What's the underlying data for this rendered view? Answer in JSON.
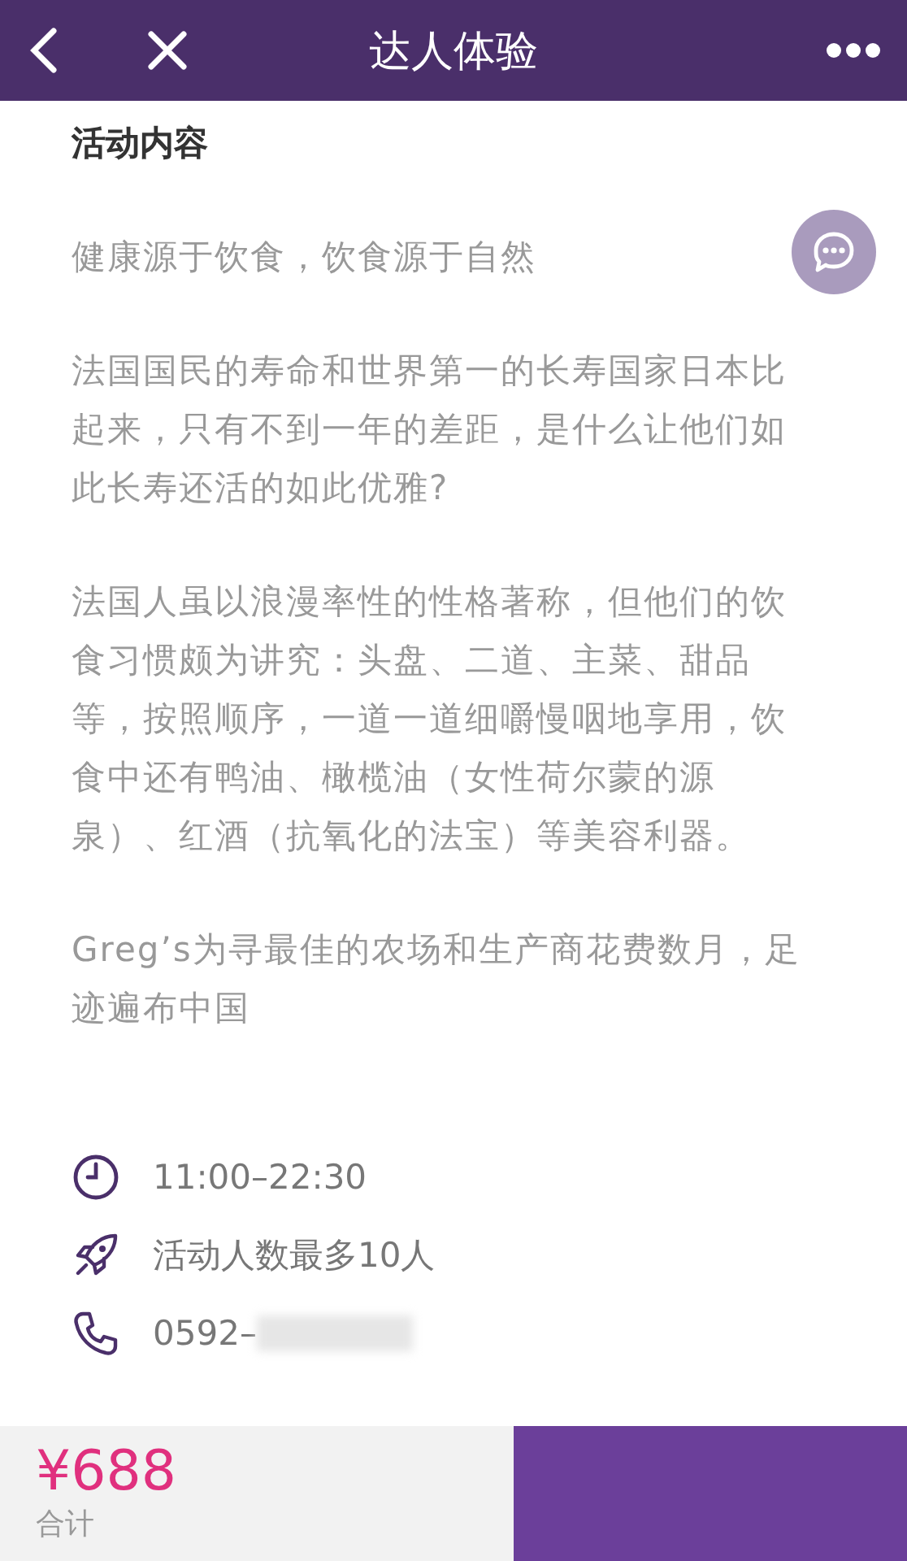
{
  "header": {
    "title": "达人体验"
  },
  "section_title": "活动内容",
  "paragraphs": [
    "健康源于饮食，饮食源于自然",
    "法国国民的寿命和世界第一的长寿国家日本比起来，只有不到一年的差距，是什么让他们如此长寿还活的如此优雅?",
    "法国人虽以浪漫率性的性格著称，但他们的饮食习惯颇为讲究：头盘、二道、主菜、甜品等，按照顺序，一道一道细嚼慢咽地享用，饮食中还有鸭油、橄榄油（女性荷尔蒙的源泉）、红酒（抗氧化的法宝）等美容利器。",
    "Greg’s为寻最佳的农场和生产商花费数月，足迹遍布中国"
  ],
  "info": [
    {
      "kind": "time",
      "text": "11:00–22:30"
    },
    {
      "kind": "capacity",
      "text": "活动人数最多10人"
    },
    {
      "kind": "phone",
      "text": "0592–",
      "redacted": true
    }
  ],
  "footer": {
    "price": "¥688",
    "total_label": "合计"
  }
}
